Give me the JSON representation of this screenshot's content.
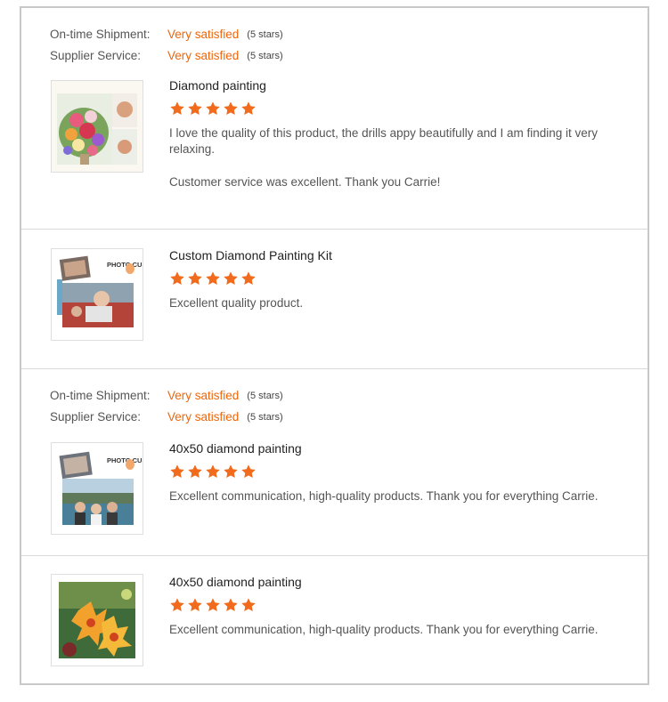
{
  "groups": [
    {
      "ratings": {
        "shipment": {
          "label": "On-time Shipment:",
          "value": "Very satisfied",
          "stars": "(5 stars)"
        },
        "service": {
          "label": "Supplier Service:",
          "value": "Very satisfied",
          "stars": "(5 stars)"
        }
      },
      "reviews": [
        {
          "title": "Diamond painting",
          "rating": 5,
          "image": "flower-bouquet-painting",
          "paragraphs": [
            "I love the quality of this product, the drills appy beautifully and I am finding it very relaxing.",
            "Customer service was excellent. Thank you Carrie!"
          ]
        },
        {
          "title": "Custom Diamond Painting Kit",
          "rating": 5,
          "image": "custom-photo-kit",
          "badge": "PHOTO CUSTOM",
          "paragraphs": [
            "Excellent quality product."
          ]
        }
      ]
    },
    {
      "ratings": {
        "shipment": {
          "label": "On-time Shipment:",
          "value": "Very satisfied",
          "stars": "(5 stars)"
        },
        "service": {
          "label": "Supplier Service:",
          "value": "Very satisfied",
          "stars": "(5 stars)"
        }
      },
      "reviews": [
        {
          "title": "40x50 diamond painting",
          "rating": 5,
          "image": "custom-photo-group",
          "badge": "PHOTO CUSTOM",
          "paragraphs": [
            "Excellent communication, high-quality products. Thank you for everything Carrie."
          ]
        },
        {
          "title": "40x50 diamond painting",
          "rating": 5,
          "image": "hibiscus-painting",
          "paragraphs": [
            "Excellent communication, high-quality products. Thank you for everything Carrie."
          ]
        }
      ]
    }
  ],
  "colors": {
    "accent": "#f0660a",
    "star": "#f26a1b",
    "border": "#c8c8c8",
    "divider": "#d9d9d9"
  }
}
